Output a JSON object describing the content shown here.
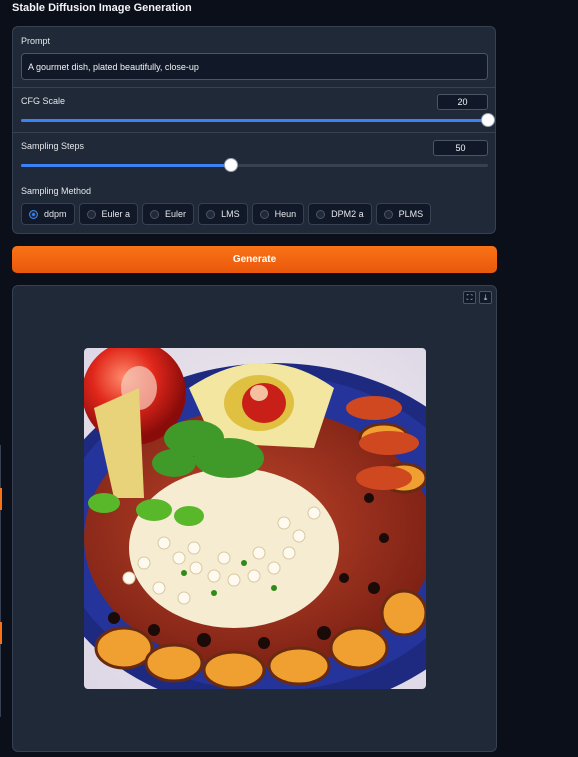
{
  "app": {
    "title": "Stable Diffusion Image Generation"
  },
  "prompt": {
    "label": "Prompt",
    "value": "A gourmet dish, plated beautifully, close-up"
  },
  "cfg": {
    "label": "CFG Scale",
    "value": "20",
    "fraction": 1.0
  },
  "steps": {
    "label": "Sampling Steps",
    "value": "50",
    "fraction": 0.45
  },
  "sampler": {
    "label": "Sampling Method",
    "options": [
      "ddpm",
      "Euler a",
      "Euler",
      "LMS",
      "Heun",
      "DPM2 a",
      "PLMS"
    ],
    "selected": "ddpm"
  },
  "generate": {
    "label": "Generate"
  },
  "output": {
    "fullscreen_icon": "fullscreen-icon",
    "download_icon": "download-icon",
    "image": "generated food dish"
  },
  "colors": {
    "accent": "#f97316",
    "slider": "#3b82f6",
    "background": "#0b0f19",
    "panel": "#1f2937"
  }
}
